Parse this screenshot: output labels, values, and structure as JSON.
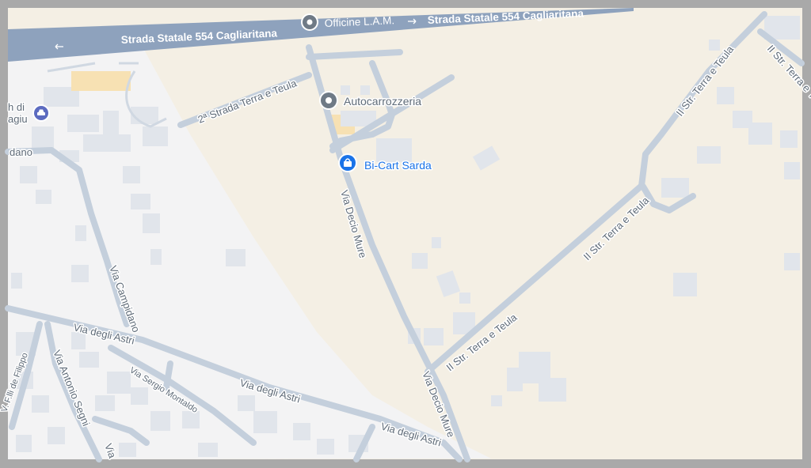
{
  "map": {
    "colors": {
      "land_rural": "#f4efe4",
      "land_urban": "#f3f3f4",
      "road": "#c4cfdc",
      "highway": "#8ea2bd",
      "building": "#e1e5eb",
      "building_beige": "#f7e1b3",
      "poi_gray": "#6f7a86",
      "poi_blue": "#1a73e8",
      "frame": "#a9a9a9"
    },
    "highway": {
      "label_left": "Strada Statale 554 Cagliaritana",
      "label_right": "Strada Statale 554 Cagliaritana"
    },
    "roads": {
      "via_decio_mure_1": "Via Decio Mure",
      "via_decio_mure_2": "Via Decio Mure",
      "second_str_terra_teula": "2ª Strada Terra e Teula",
      "ii_str_terra_teula_1": "II Str. Terra e Teula",
      "ii_str_terra_teula_2": "II Str. Terra e Teula",
      "ii_str_terra_teula_3": "II Str. Terra e Teula",
      "ii_str_terra_teula_4": "II Str. Terra e Teula",
      "ii_str_terra_teula_5": "II Str. Terra e Teula",
      "via_campidano": "Via Campidano",
      "via_campidano_cut": "dano",
      "via_degli_astri_1": "Via degli Astri",
      "via_degli_astri_2": "Via degli Astri",
      "via_degli_astri_3": "Via degli Astri",
      "via_sergio_montaldo": "Via Sergio Montaldo",
      "via_antonio_segni": "Via Antonio Segni",
      "via_antonio_segni_cut": "Via",
      "via_flli_de_filippo": "V. F.lli de Filippo"
    },
    "pois": [
      {
        "name": "Officine L.A.M.",
        "icon": "place-pin-icon"
      },
      {
        "name": "Autocarrozzeria",
        "icon": "place-pin-icon"
      },
      {
        "name": "Bi-Cart Sarda",
        "icon": "shopping-bag-icon"
      }
    ],
    "partial_poi": {
      "line1": "h di",
      "line2": "agiu",
      "icon": "car-icon"
    }
  }
}
